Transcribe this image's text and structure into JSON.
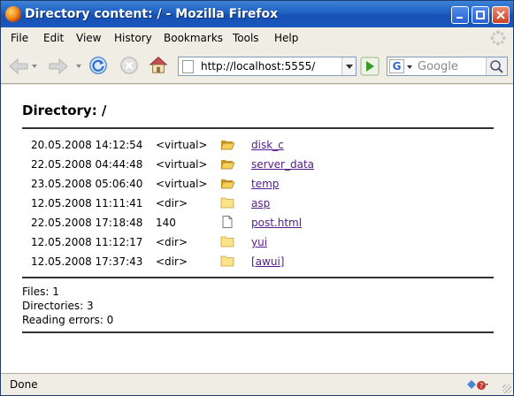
{
  "window": {
    "title": "Directory content: / - Mozilla Firefox",
    "accent": "#1f5fc1"
  },
  "menu": [
    "File",
    "Edit",
    "View",
    "History",
    "Bookmarks",
    "Tools",
    "Help"
  ],
  "toolbar": {
    "icons": [
      "back-arrow-icon",
      "forward-arrow-icon",
      "reload-icon",
      "stop-icon",
      "home-icon",
      "go-icon"
    ],
    "url": "http://localhost:5555/",
    "search_engine_icon": "G",
    "search_placeholder": "Google"
  },
  "page": {
    "heading": "Directory: /",
    "entries": [
      {
        "date": "20.05.2008 14:12:54",
        "info": "<virtual>",
        "icon": "open-folder-icon",
        "name": "disk_c"
      },
      {
        "date": "22.05.2008 04:44:48",
        "info": "<virtual>",
        "icon": "open-folder-icon",
        "name": "server_data"
      },
      {
        "date": "23.05.2008 05:06:40",
        "info": "<virtual>",
        "icon": "open-folder-icon",
        "name": "temp"
      },
      {
        "date": "12.05.2008 11:11:41",
        "info": "<dir>",
        "icon": "folder-icon",
        "name": "asp"
      },
      {
        "date": "22.05.2008 17:18:48",
        "info": "140",
        "icon": "file-icon",
        "name": "post.html"
      },
      {
        "date": "12.05.2008 11:12:17",
        "info": "<dir>",
        "icon": "folder-icon",
        "name": "yui"
      },
      {
        "date": "12.05.2008 17:37:43",
        "info": "<dir>",
        "icon": "folder-icon",
        "name": "[awui]"
      }
    ],
    "summary": {
      "files": "Files: 1",
      "directories": "Directories: 3",
      "errors": "Reading errors: 0"
    },
    "link_color": "#551a8b"
  },
  "status": {
    "text": "Done"
  }
}
